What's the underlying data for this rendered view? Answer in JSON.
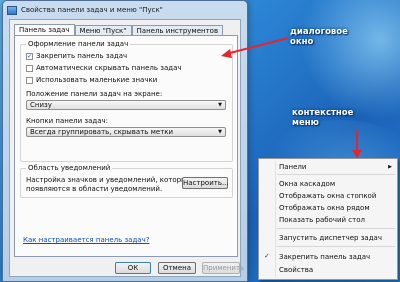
{
  "window": {
    "title": "Свойства панели задач и меню \"Пуск\""
  },
  "tabs": [
    {
      "label": "Панель задач"
    },
    {
      "label": "Меню \"Пуск\""
    },
    {
      "label": "Панель инструментов"
    }
  ],
  "taskbar_group": {
    "legend": "Оформление панели задач",
    "checkboxes": [
      {
        "label": "Закрепить панель задач",
        "checked": true
      },
      {
        "label": "Автоматически скрывать панель задач",
        "checked": false
      },
      {
        "label": "Использовать маленькие значки",
        "checked": false
      }
    ],
    "position_label": "Положение панели задач на экране:",
    "position_value": "Снизу",
    "buttons_label": "Кнопки панели задач:",
    "buttons_value": "Всегда группировать, скрывать метки"
  },
  "notify_group": {
    "legend": "Область уведомлений",
    "text": "Настройка значков и уведомлений, которые появляются в области уведомлений.",
    "text_line1": "Настройка значков и уведомлений, которые",
    "text_line2": "появляются в области уведомлений.",
    "configure_button": "Настроить..."
  },
  "help_link": "Как настраивается панель задач?",
  "footer": {
    "ok": "ОК",
    "cancel": "Отмена",
    "apply": "Применить"
  },
  "annotations": {
    "dialog": [
      "диалоговое",
      "окно"
    ],
    "context": [
      "контекстное",
      "меню"
    ]
  },
  "context_menu": {
    "items": [
      {
        "label": "Панели",
        "submenu": true
      },
      {
        "label": "Окна каскадом"
      },
      {
        "label": "Отображать окна стопкой"
      },
      {
        "label": "Отображать окна рядом"
      },
      {
        "label": "Показать рабочий стол"
      },
      {
        "label": "Запустить диспетчер задач"
      },
      {
        "label": "Закрепить панель задач",
        "checked": true
      },
      {
        "label": "Свойства"
      }
    ]
  },
  "colors": {
    "arrow": "#e8232a",
    "link": "#0a4fc0"
  }
}
